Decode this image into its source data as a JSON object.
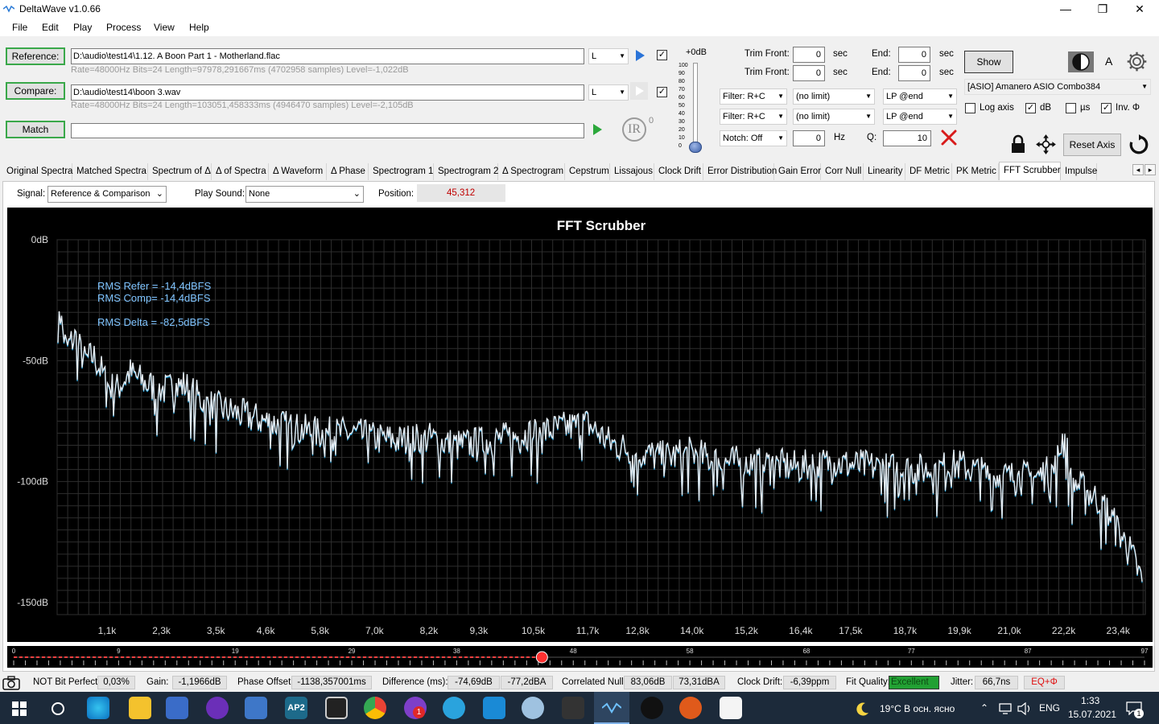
{
  "window": {
    "title": "DeltaWave v1.0.66",
    "minimize": "—",
    "maximize": "❐",
    "close": "✕"
  },
  "menu": [
    "File",
    "Edit",
    "Play",
    "Process",
    "View",
    "Help"
  ],
  "reference": {
    "button": "Reference:",
    "path": "D:\\audio\\test14\\1.12. A Boon Part 1 - Motherland.flac",
    "info": "Rate=48000Hz Bits=24 Length=97978,291667ms (4702958 samples) Level=-1,022dB",
    "channel": "L",
    "checked": true
  },
  "compare": {
    "button": "Compare:",
    "path": "D:\\audio\\test14\\boon 3.wav",
    "info": "Rate=48000Hz Bits=24 Length=103051,458333ms (4946470 samples) Level=-2,105dB",
    "channel": "L",
    "checked": true
  },
  "match": {
    "button": "Match",
    "value": ""
  },
  "ir_label": "IR",
  "ir_sup": "0",
  "volume": {
    "label": "+0dB",
    "ticks": [
      "100",
      "90",
      "80",
      "70",
      "60",
      "50",
      "40",
      "30",
      "20",
      "10",
      "0"
    ],
    "level": 0
  },
  "trim": {
    "front_label": "Trim Front:",
    "front1": "0",
    "front2": "0",
    "end_label": "End:",
    "end1": "0",
    "end2": "0",
    "unit": "sec"
  },
  "show_button": "Show",
  "a_label": "A",
  "filters": {
    "row1": {
      "filter": "Filter: R+C",
      "limit": "(no limit)",
      "lp": "LP @end"
    },
    "row2": {
      "filter": "Filter: R+C",
      "limit": "(no limit)",
      "lp": "LP @end"
    },
    "notch": "Notch: Off",
    "hz_value": "0",
    "hz_label": "Hz",
    "q_label": "Q:",
    "q_value": "10"
  },
  "device": "[ASIO] Amanero ASIO Combo384",
  "options": [
    {
      "label": "Log axis",
      "checked": false
    },
    {
      "label": "dB",
      "checked": true
    },
    {
      "label": "µs",
      "checked": false
    },
    {
      "label": "Inv. Φ",
      "checked": true
    }
  ],
  "reset_axis": "Reset Axis",
  "tabs": [
    "Original Spectra",
    "Matched Spectra",
    "Spectrum of Δ",
    "Δ of Spectra",
    "Δ Waveform",
    "Δ Phase",
    "Spectrogram 1",
    "Spectrogram 2",
    "Δ Spectrogram",
    "Cepstrum",
    "Lissajous",
    "Clock Drift",
    "Error Distribution",
    "Gain Error",
    "Corr Null",
    "Linearity",
    "DF Metric",
    "PK Metric",
    "FFT Scrubber",
    "Impulse"
  ],
  "active_tab": "FFT Scrubber",
  "tab_scroll": {
    "left": "◂",
    "right": "▸"
  },
  "controls": {
    "signal_label": "Signal:",
    "signal_value": "Reference & Comparison",
    "play_label": "Play Sound:",
    "play_value": "None",
    "position_label": "Position:",
    "position_value": "45,312"
  },
  "colors": {
    "trace": "#e6ecf2",
    "trace_under": "#2aa7e0",
    "annotation": "#7fc4ff",
    "position": "#c00000",
    "slider_thumb": "#ff3030",
    "excellent": "#22a033"
  },
  "chart_data": {
    "type": "line",
    "title": "FFT Scrubber",
    "ylim": [
      -155,
      0
    ],
    "xlim": [
      0,
      24000
    ],
    "y_ticks": [
      "0dB",
      "-50dB",
      "-100dB",
      "-150dB"
    ],
    "y_tick_values": [
      0,
      -50,
      -100,
      -150
    ],
    "x_ticks": [
      "1,1k",
      "2,3k",
      "3,5k",
      "4,6k",
      "5,8k",
      "7,0k",
      "8,2k",
      "9,3k",
      "10,5k",
      "11,7k",
      "12,8k",
      "14,0k",
      "15,2k",
      "16,4k",
      "17,5k",
      "18,7k",
      "19,9k",
      "21,0k",
      "22,2k",
      "23,4k"
    ],
    "x_tick_values": [
      1100,
      2300,
      3500,
      4600,
      5800,
      7000,
      8200,
      9300,
      10500,
      11700,
      12800,
      14000,
      15200,
      16400,
      17500,
      18700,
      19900,
      21000,
      22200,
      23400
    ],
    "annotations": [
      "RMS Refer = -14,4dBFS",
      "RMS Comp= -14,4dBFS",
      "RMS Delta = -82,5dBFS"
    ],
    "grid": true,
    "series": [
      {
        "x": [
          0,
          100,
          200,
          400,
          600,
          800,
          1000,
          1100,
          1300,
          1600,
          2000,
          2400,
          2800,
          3300,
          4000,
          4600,
          5200,
          5800,
          6500,
          7000,
          7600,
          8200,
          8800,
          9300,
          9900,
          10500,
          11100,
          11700,
          12200,
          12800,
          13400,
          14000,
          14600,
          15200,
          15800,
          16400,
          17000,
          17500,
          18100,
          18700,
          19300,
          19900,
          20500,
          21000,
          21600,
          22000,
          22200,
          22400,
          22800,
          23100,
          23400,
          23700,
          24000
        ],
        "y": [
          -20,
          -35,
          -45,
          -40,
          -50,
          -48,
          -55,
          -60,
          -62,
          -55,
          -60,
          -62,
          -60,
          -68,
          -72,
          -75,
          -78,
          -80,
          -80,
          -82,
          -83,
          -82,
          -85,
          -84,
          -82,
          -80,
          -78,
          -76,
          -84,
          -88,
          -90,
          -88,
          -92,
          -92,
          -93,
          -94,
          -92,
          -93,
          -94,
          -95,
          -95,
          -93,
          -97,
          -98,
          -98,
          -95,
          -80,
          -100,
          -105,
          -110,
          -120,
          -130,
          -145
        ]
      }
    ]
  },
  "slider": {
    "ticks": [
      "0",
      "9",
      "19",
      "29",
      "38",
      "48",
      "58",
      "68",
      "77",
      "87",
      "97"
    ],
    "value": 45.312,
    "max": 97
  },
  "status": {
    "bit_perfect": "NOT Bit Perfect",
    "bp_value": "0,03%",
    "gain_label": "Gain:",
    "gain_value": "-1,1966dB",
    "phase_label": "Phase Offset:",
    "phase_value": "-1138,357001ms",
    "diff_label": "Difference (ms):",
    "diff_value1": "-74,69dB",
    "diff_value2": "-77,2dBA",
    "null_label": "Correlated Null:",
    "null_value1": "83,06dB",
    "null_value2": "73,31dBA",
    "drift_label": "Clock Drift:",
    "drift_value": "-6,39ppm",
    "fit_label": "Fit Quality:",
    "fit_value": "Excellent",
    "jitter_label": "Jitter:",
    "jitter_value": "66,7ns",
    "eq_label": "EQ+Φ"
  },
  "taskbar": {
    "weather": "19°C  В осн. ясно",
    "lang": "ENG",
    "time": "1:33",
    "date": "15.07.2021",
    "badge": "1",
    "notif_count": "1",
    "ap_label": "AP2"
  }
}
